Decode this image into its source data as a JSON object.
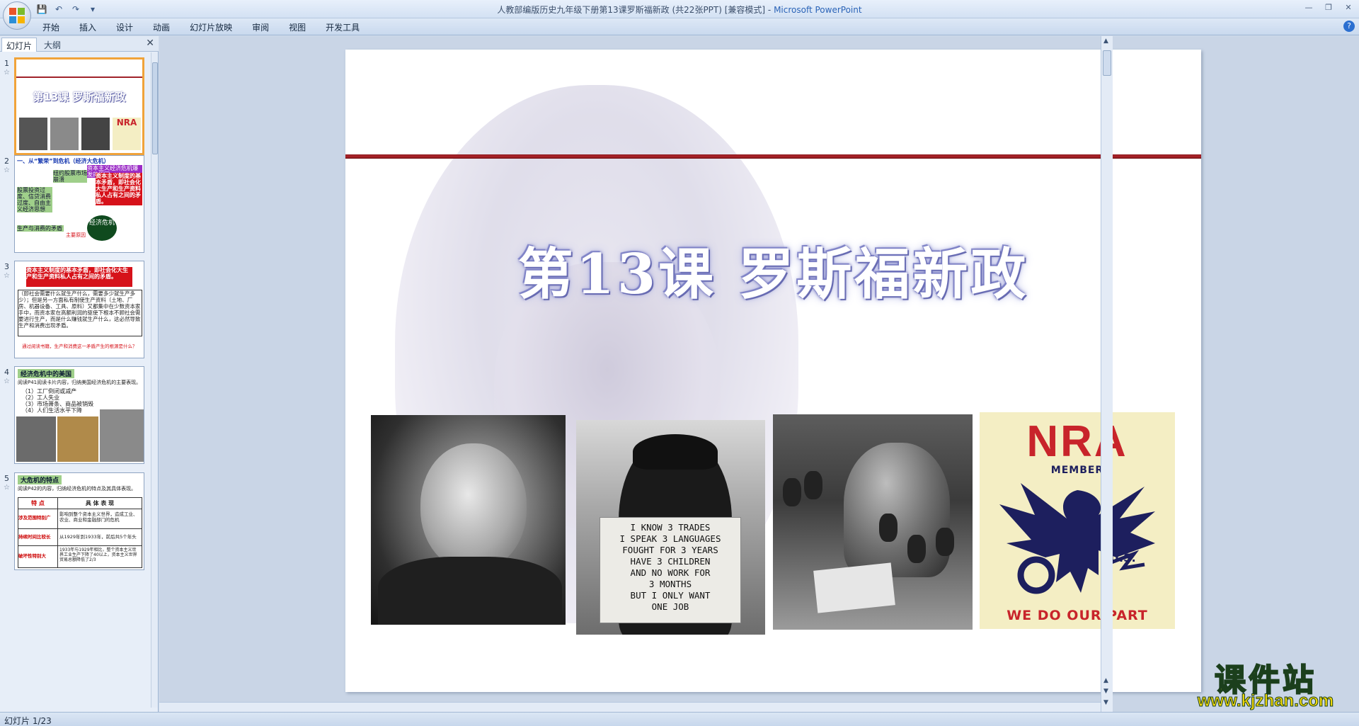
{
  "window": {
    "title_doc": "人教部编版历史九年级下册第13课罗斯福新政 (共22张PPT) [兼容模式] - ",
    "title_app": "Microsoft PowerPoint"
  },
  "ribbon": {
    "tabs": [
      "开始",
      "插入",
      "设计",
      "动画",
      "幻灯片放映",
      "审阅",
      "视图",
      "开发工具"
    ]
  },
  "pane": {
    "tab_slides": "幻灯片",
    "tab_outline": "大纲"
  },
  "thumbnails": [
    {
      "num": "1",
      "title": "第13课 罗斯福新政"
    },
    {
      "num": "2",
      "heading": "一、从“繁荣”到危机（经济大危机）",
      "box_top": "资本主义经济危机爆发的原因",
      "box_left": "股票投资过度、信贷消费过度、自由主义经济思想",
      "box_mid": "纽约股票市场崩溃",
      "box_right": "资本主义制度的基本矛盾，即社会化大生产和生产资料私人占有之间的矛盾。",
      "box_bottom": "生产与消费的矛盾",
      "circle": "经济危机",
      "label_bottom": "主要原因"
    },
    {
      "num": "3",
      "red_box": "资本主义制度的基本矛盾，即社会化大生产和生产资料私人占有之间的矛盾。",
      "body": "（即社会需要什么就生产什么，需要多少就生产多少）；但是另一方面私有制使生产资料（土地、厂房、机器设备、工具、原料）又都集中在少数资本家手中，而资本家在高额利润的驱使下根本不顾社会需要进行生产，而是什么赚钱就生产什么，这必然导致生产和消费出现矛盾。",
      "question": "通过阅读书籍，生产和消费这一矛盾产生的根源是什么？"
    },
    {
      "num": "4",
      "heading": "经济危机中的美国",
      "intro": "阅读P41阅读卡片内容，归纳美国经济危机的主要表现。",
      "items": [
        "（1）工厂倒闭或减产",
        "（2）工人失业",
        "（3）市场萧条、商品被销毁",
        "（4）人们生活水平下降"
      ]
    },
    {
      "num": "5",
      "heading": "大危机的特点",
      "intro": "阅读P42的内容，归纳经济危机的特点及其具体表现。",
      "col1": "特 点",
      "col2": "具 体 表 现",
      "rows": [
        [
          "涉及范围特别广",
          "影响到整个资本主义世界，造成工业、农业、商业和金融部门的危机"
        ],
        [
          "持续时间比较长",
          "从1929年到1933年，前后共5个年头"
        ],
        [
          "破坏性特别大",
          "1933年与1929年相比，整个资本主义世界工业生产下降了40以上，资本主义世界贸易总额降低了2/3"
        ]
      ]
    }
  ],
  "slide": {
    "title": "第13课  罗斯福新政",
    "sign_lines": [
      "I KNOW 3 TRADES",
      "I SPEAK 3 LANGUAGES",
      "FOUGHT FOR 3 YEARS",
      "HAVE 3 CHILDREN",
      "AND NO WORK FOR",
      "3 MONTHS",
      "BUT I ONLY WANT",
      "ONE JOB"
    ],
    "nra": {
      "letters": "NRA",
      "member": "MEMBER",
      "us": "U.S.",
      "slogan": "WE DO OUR PART"
    }
  },
  "watermark": {
    "title": "课件站",
    "url": "www.kjzhan.com"
  },
  "status": {
    "text": "幻灯片 1/23"
  },
  "colors": {
    "accent_red": "#b0242a",
    "nra_red": "#c8242b",
    "nra_blue": "#1d1f5e",
    "selected_border": "#f0a33a"
  }
}
